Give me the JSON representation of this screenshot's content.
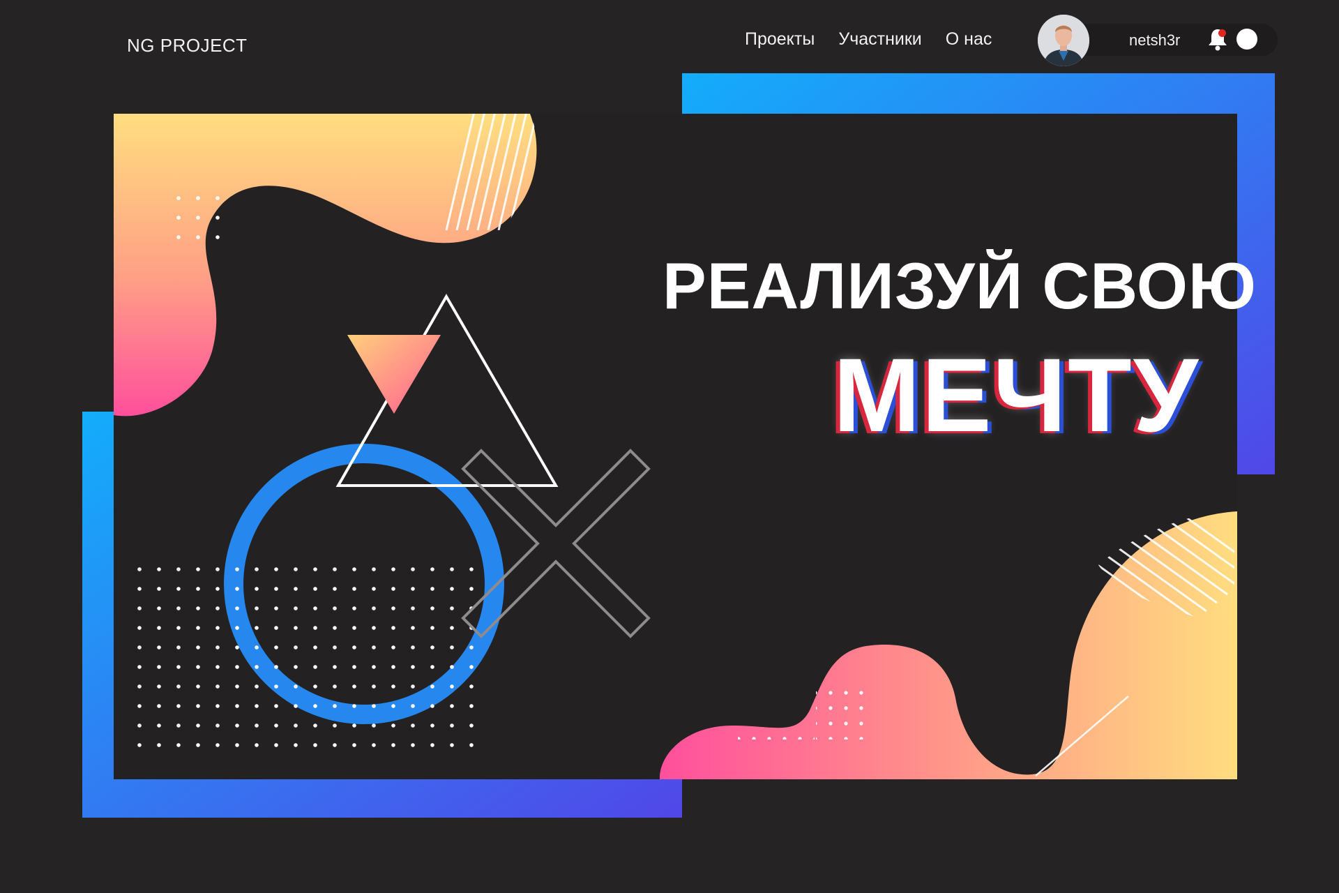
{
  "header": {
    "logo": "NG PROJECT",
    "nav": [
      {
        "label": "Проекты"
      },
      {
        "label": "Участники"
      },
      {
        "label": "О нас"
      }
    ],
    "user": {
      "name": "netsh3r",
      "has_notification": true
    }
  },
  "hero": {
    "headline": "РЕАЛИЗУЙ СВОЮ",
    "headline_accent": "МЕЧТУ"
  },
  "colors": {
    "background": "#252324",
    "panel": "#232122",
    "frame_gradient": [
      "#13adfb",
      "#5147e8"
    ],
    "blob_gradient": [
      "#ffdf7f",
      "#ff4f9a"
    ],
    "ring": "#2687ee",
    "notification_dot": "#e0271f"
  },
  "icons": [
    "bell-icon",
    "theme-toggle-icon"
  ]
}
